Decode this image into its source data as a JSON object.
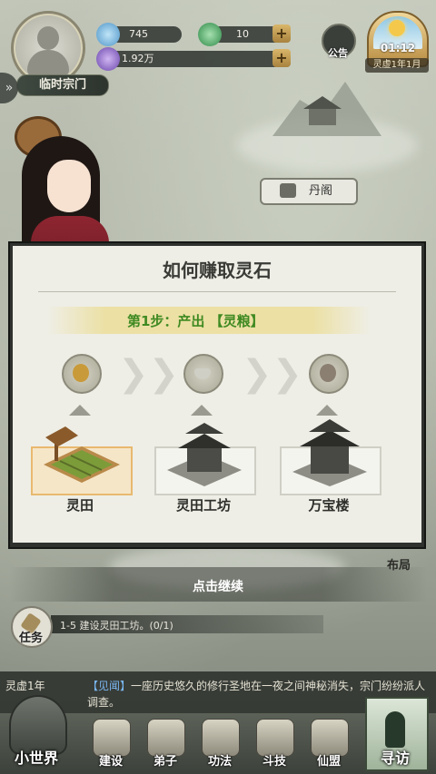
{
  "player": {
    "sect_label": "临时宗门"
  },
  "resources": [
    {
      "name": "spirit-stone",
      "value": "745",
      "icon": "blue-crystal-icon",
      "color": "#5aa3d8"
    },
    {
      "name": "jade",
      "value": "10",
      "icon": "green-jade-icon",
      "color": "#3f9d58",
      "has_plus": true
    },
    {
      "name": "purple-crystal",
      "value": "1.92万",
      "icon": "purple-crystal-icon",
      "color": "#7f5cbf",
      "has_plus": true
    }
  ],
  "notice": {
    "label": "公告"
  },
  "clock": {
    "time": "01:12",
    "date": "灵虚1年1月"
  },
  "building_tag": {
    "label": "丹阁"
  },
  "dialog": {
    "title": "如何赚取灵石",
    "step": "第1步：产出 【灵粮】",
    "items": [
      {
        "label": "灵田",
        "icon": "grain-icon",
        "active": true
      },
      {
        "label": "灵田工坊",
        "icon": "bowl-icon",
        "active": false
      },
      {
        "label": "万宝楼",
        "icon": "stone-icon",
        "active": false
      }
    ]
  },
  "continue_label": "点击继续",
  "layout_label": "布局",
  "task": {
    "label": "任务",
    "text": "1-5 建设灵田工坊。(0/1)"
  },
  "news": {
    "era": "灵虚1年",
    "tag": "【见闻】",
    "text": "一座历史悠久的修行圣地在一夜之间神秘消失，宗门纷纷派人调查。"
  },
  "nav": {
    "world": "小世界",
    "items": [
      "建设",
      "弟子",
      "功法",
      "斗技",
      "仙盟"
    ],
    "visit": "寻访"
  }
}
